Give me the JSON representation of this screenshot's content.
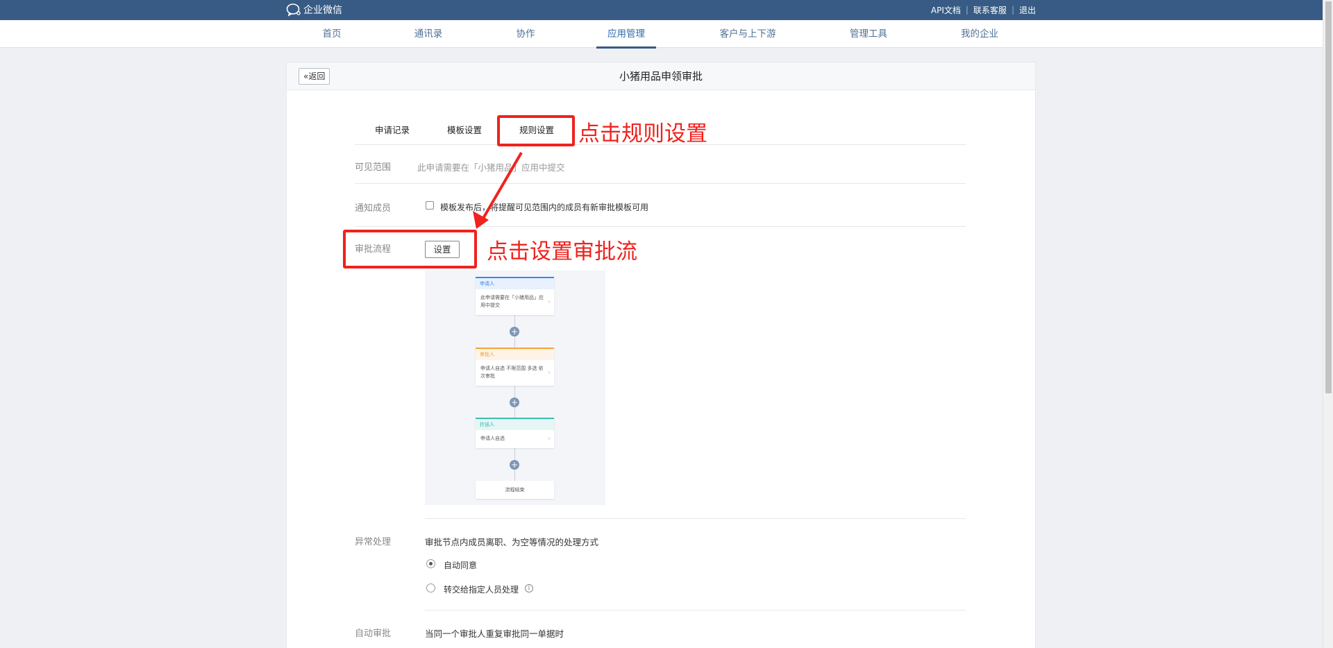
{
  "topbar": {
    "logo_text": "企业微信",
    "links": [
      "API文档",
      "联系客服",
      "退出"
    ]
  },
  "nav": {
    "items": [
      "首页",
      "通讯录",
      "协作",
      "应用管理",
      "客户与上下游",
      "管理工具",
      "我的企业"
    ],
    "active": "应用管理"
  },
  "panel": {
    "back_label": "«返回",
    "title": "小猪用品申领审批"
  },
  "tabs": [
    "申请记录",
    "模板设置",
    "规则设置"
  ],
  "visible_range": {
    "label": "可见范围",
    "text": "此申请需要在「小猪用品」应用中提交"
  },
  "notify": {
    "label": "通知成员",
    "checkbox_text": "模板发布后，将提醒可见范围内的成员有新审批模板可用",
    "checked": false
  },
  "flow_setting": {
    "label": "审批流程",
    "button": "设置"
  },
  "flow_preview": {
    "nodes": [
      {
        "head": "申请人",
        "body": "此申请需要在「小猪用品」应用中提交",
        "color": "#3a86e8",
        "headbg": "#e8f1fd",
        "headcolor": "#3a86e8"
      },
      {
        "head": "审批人",
        "body": "申请人自选 不限范围 多选 依次审批",
        "color": "#f5a23a",
        "headbg": "#fdf3e6",
        "headcolor": "#f0a040"
      },
      {
        "head": "抄送人",
        "body": "申请人自选",
        "color": "#3bbfb4",
        "headbg": "#e5f6f4",
        "headcolor": "#3bb3a9"
      }
    ],
    "end_label": "流程结束"
  },
  "exception": {
    "label": "异常处理",
    "desc": "审批节点内成员离职、为空等情况的处理方式",
    "options": [
      {
        "label": "自动同意",
        "checked": true
      },
      {
        "label": "转交给指定人员处理",
        "checked": false
      }
    ]
  },
  "auto_approve": {
    "label": "自动审批",
    "desc": "当同一个审批人重复审批同一单据时"
  },
  "annotations": {
    "click_rules": "点击规则设置",
    "click_flow": "点击设置审批流",
    "color": "#f0221d"
  }
}
